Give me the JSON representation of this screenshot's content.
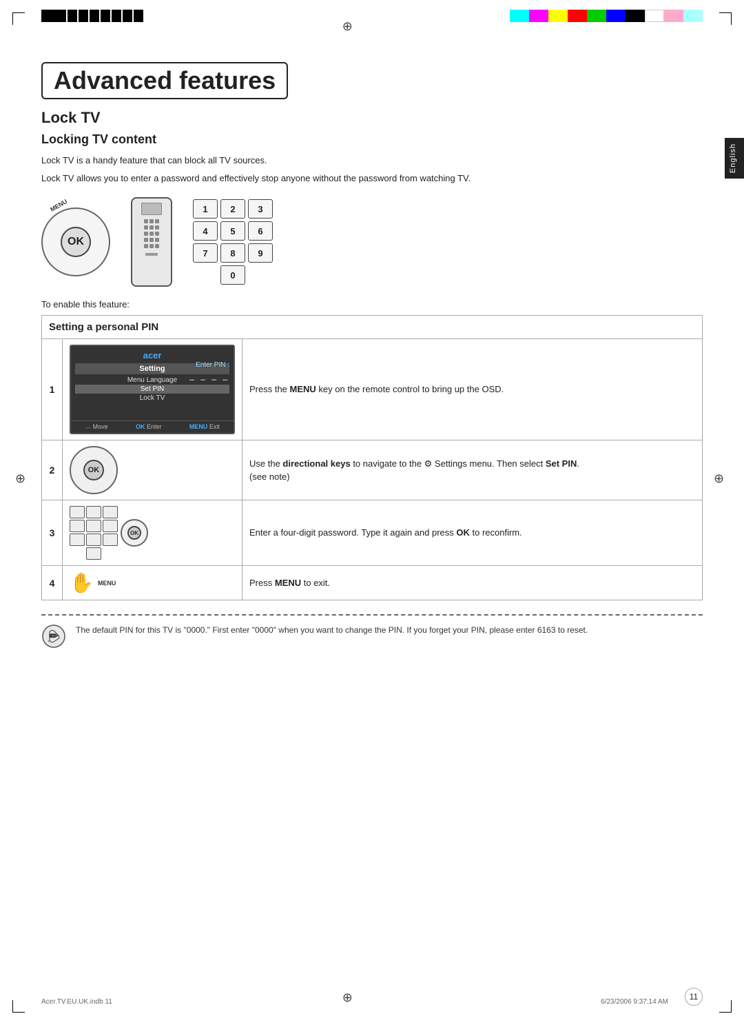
{
  "page": {
    "title": "Advanced features",
    "section": "Lock TV",
    "subsection": "Locking TV content",
    "body_text_1": "Lock TV is a handy feature that can block all TV sources.",
    "body_text_2": "Lock TV allows you to enter a password and effectively stop anyone without the password from watching TV.",
    "enable_text": "To enable this feature:",
    "side_tab": "English",
    "page_number": "11",
    "footer_left": "Acer.TV.EU.UK.indb  11",
    "footer_right": "6/23/2006  9:37:14 AM"
  },
  "numpad": {
    "keys": [
      "1",
      "2",
      "3",
      "4",
      "5",
      "6",
      "7",
      "8",
      "9",
      "0"
    ]
  },
  "steps_table": {
    "header": "Setting a personal PIN",
    "steps": [
      {
        "num": "1",
        "text": "Press the MENU key on the remote control to bring up the OSD."
      },
      {
        "num": "2",
        "text": "Use the directional keys to navigate to the Settings menu. Then select Set PIN. (see note)"
      },
      {
        "num": "3",
        "text": "Enter a four-digit password. Type it again and press OK to reconfirm."
      },
      {
        "num": "4",
        "text": "Press MENU to exit."
      }
    ]
  },
  "osd": {
    "brand": "acer",
    "menu_title": "Setting",
    "items": [
      "Menu Language",
      "Set PIN",
      "Lock TV"
    ],
    "enter_pin_label": "Enter PIN :",
    "pin_dots": "_ _ _ _",
    "footer": [
      "Move",
      "Enter",
      "Exit"
    ]
  },
  "note": {
    "text": "The default PIN for this TV is \"0000.\" First enter \"0000\" when you want to change the PIN. If you forget your PIN, please enter 6163 to reset."
  },
  "colors": {
    "cyan": "#00ffff",
    "magenta": "#ff00ff",
    "yellow": "#ffff00",
    "red": "#ff0000",
    "green": "#00ff00",
    "blue": "#0000ff",
    "black": "#000000",
    "white": "#ffffff",
    "pink_light": "#ffaacc",
    "cyan_light": "#aaffff"
  }
}
